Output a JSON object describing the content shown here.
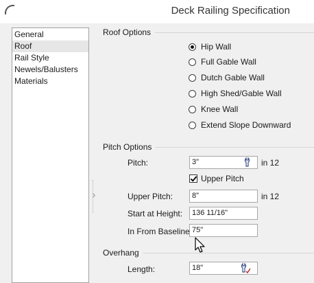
{
  "window": {
    "title": "Deck Railing Specification"
  },
  "sidebar": {
    "items": [
      {
        "label": "General"
      },
      {
        "label": "Roof",
        "selected": true
      },
      {
        "label": "Rail Style"
      },
      {
        "label": "Newels/Balusters"
      },
      {
        "label": "Materials"
      }
    ]
  },
  "roof_options": {
    "title": "Roof Options",
    "options": [
      {
        "label": "Hip Wall",
        "checked": true
      },
      {
        "label": "Full Gable Wall"
      },
      {
        "label": "Dutch Gable Wall"
      },
      {
        "label": "High Shed/Gable Wall"
      },
      {
        "label": "Knee Wall"
      },
      {
        "label": "Extend Slope Downward"
      }
    ]
  },
  "pitch_options": {
    "title": "Pitch Options",
    "pitch_label": "Pitch:",
    "pitch_value": "3\"",
    "pitch_unit": "in 12",
    "upper_pitch_checkbox_label": "Upper Pitch",
    "upper_pitch_checked": true,
    "upper_pitch_label": "Upper Pitch:",
    "upper_pitch_value": "8\"",
    "upper_pitch_unit": "in 12",
    "start_height_label": "Start at Height:",
    "start_height_value": "136 11/16\"",
    "baseline_label": "In From Baseline:",
    "baseline_value": "75\""
  },
  "overhang": {
    "title": "Overhang",
    "length_label": "Length:",
    "length_value": "18\""
  },
  "icons": {
    "app": "app-icon",
    "tool": "wrench-icon",
    "cursor": "mouse-cursor-icon"
  }
}
